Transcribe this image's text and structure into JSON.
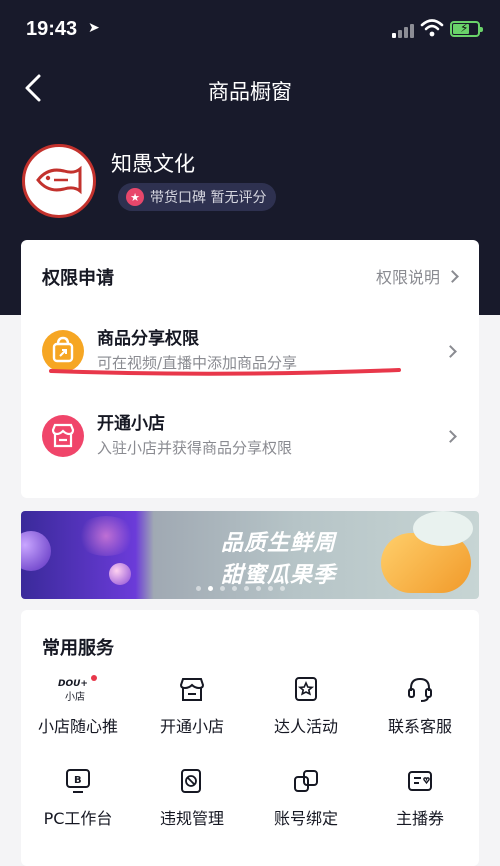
{
  "status_bar": {
    "time": "19:43"
  },
  "nav": {
    "title": "商品橱窗"
  },
  "shop": {
    "name": "知愚文化",
    "rating": "带货口碑 暂无评分"
  },
  "permissions": {
    "title": "权限申请",
    "link": "权限说明",
    "items": [
      {
        "title": "商品分享权限",
        "subtitle": "可在视频/直播中添加商品分享",
        "icon": "share-bag-icon",
        "color": "#f6a623"
      },
      {
        "title": "开通小店",
        "subtitle": "入驻小店并获得商品分享权限",
        "icon": "store-icon",
        "color": "#f0456a"
      }
    ]
  },
  "banner": {
    "line1": "品质生鲜周",
    "line2": "甜蜜瓜果季"
  },
  "services": {
    "title": "常用服务",
    "items": [
      {
        "label": "小店随心推",
        "icon": "dou-plus-icon"
      },
      {
        "label": "开通小店",
        "icon": "store-icon"
      },
      {
        "label": "达人活动",
        "icon": "star-frame-icon"
      },
      {
        "label": "联系客服",
        "icon": "headset-icon"
      },
      {
        "label": "PC工作台",
        "icon": "pc-workbench-icon"
      },
      {
        "label": "违规管理",
        "icon": "violation-icon"
      },
      {
        "label": "账号绑定",
        "icon": "link-icon"
      },
      {
        "label": "主播券",
        "icon": "coupon-icon"
      }
    ]
  },
  "colors": {
    "hero_bg": "#181a2b",
    "accent_red": "#e8374a",
    "share_orange": "#f6a623",
    "store_pink": "#f0456a"
  }
}
